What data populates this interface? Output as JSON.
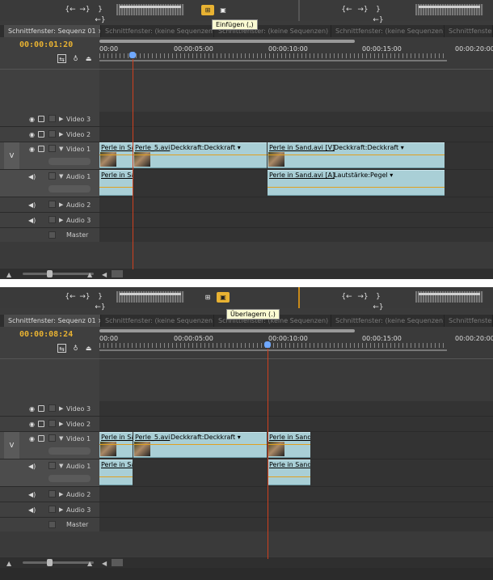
{
  "toolbar": {
    "mark_in": "{←",
    "mark_out": "→}",
    "go_to_in": "}←}",
    "insert_button": "⊞",
    "overlay_button": "▣",
    "insert_tooltip": "Einfügen (,)",
    "overlay_tooltip": "Überlagern (.)"
  },
  "tabs": {
    "active": "Schnittfenster: Sequenz 01",
    "close": "×",
    "inactive": "Schnittfenster: (keine Sequenzen)"
  },
  "panel1": {
    "timecode": "00:00:01:20",
    "ruler": [
      "00:00",
      "00:00:05:00",
      "00:00:10:00",
      "00:00:15:00",
      "00:00:20:00"
    ],
    "playhead_time": "00:00:01:20"
  },
  "panel2": {
    "timecode": "00:00:08:24",
    "ruler": [
      "00:00",
      "00:00:05:00",
      "00:00:10:00",
      "00:00:15:00",
      "00:00:20:00"
    ],
    "playhead_time": "00:00:08:24"
  },
  "tracks": {
    "video3": "Video 3",
    "video2": "Video 2",
    "video1": "Video 1",
    "audio1": "Audio 1",
    "audio2": "Audio 2",
    "audio3": "Audio 3",
    "master": "Master",
    "v_target": "V"
  },
  "clips": {
    "perle_sand_short": "Perle in Sa",
    "perle5": "Perle_5.avi",
    "deckkraft": "Deckkraft:Deckkraft ▾",
    "perle_sand_v": "Perle in Sand.avi [V]",
    "perle_sand_a": "Perle in Sand.avi [A]",
    "lautstaerke": "Lautstärke:Pegel ▾",
    "perle_sand_cut": "Perle in Sand"
  },
  "colors": {
    "timecode": "#e8b232",
    "clip_fill": "#a9cfd6",
    "playhead": "#d0401f",
    "keyline": "#e0a020",
    "active_button": "#e8b232"
  }
}
